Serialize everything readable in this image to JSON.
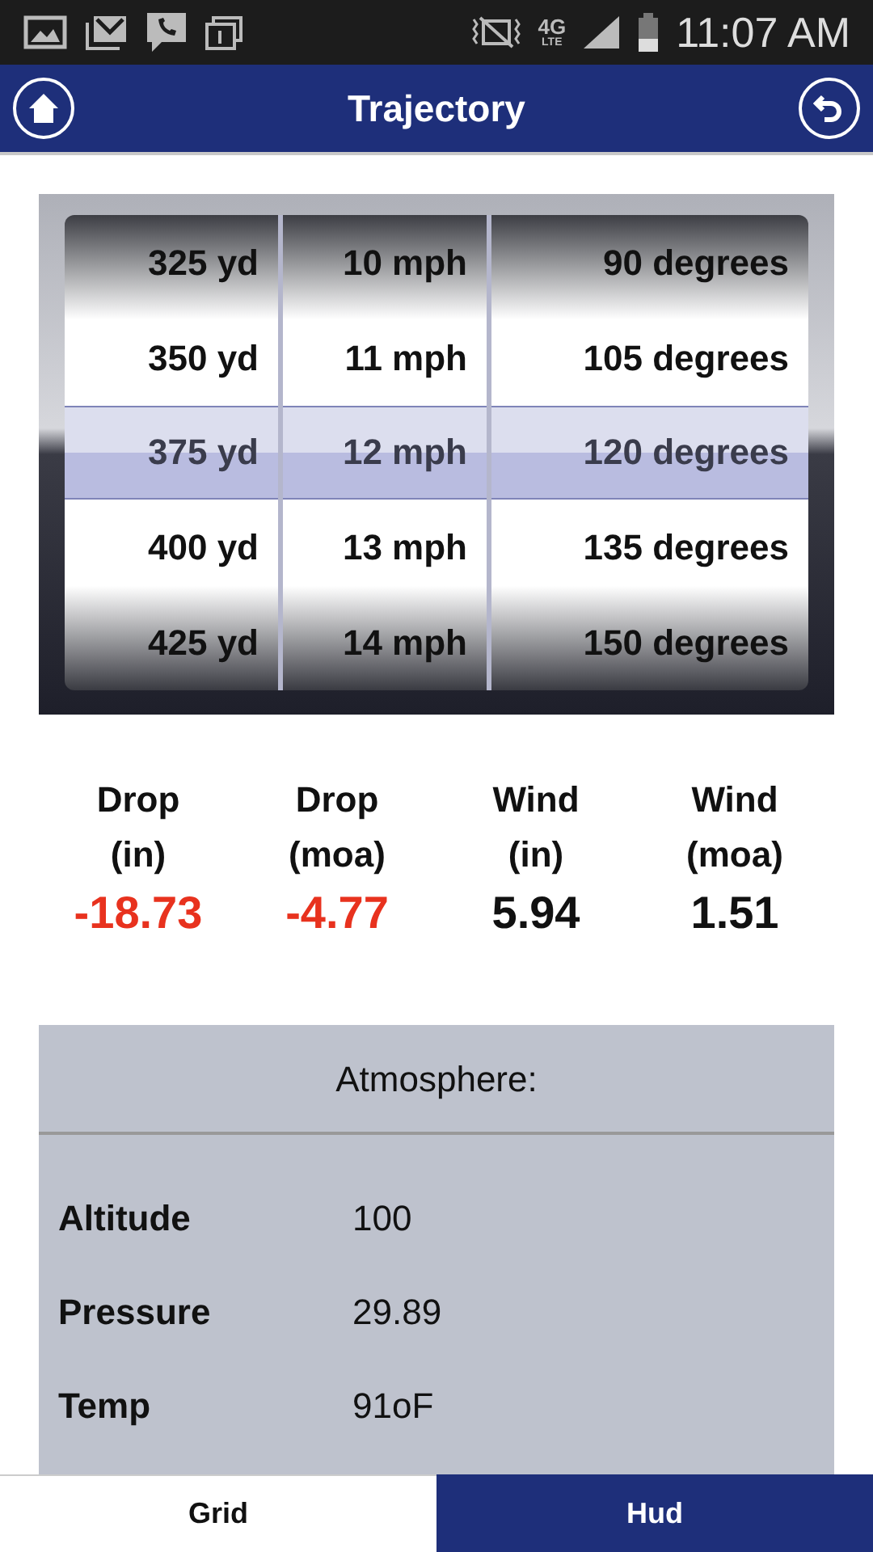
{
  "status_bar": {
    "network": "4G",
    "network_sub": "LTE",
    "time": "11:07 AM"
  },
  "header": {
    "title": "Trajectory"
  },
  "picker": {
    "columns": [
      {
        "items": [
          {
            "label": "325 yd",
            "selected": false
          },
          {
            "label": "350 yd",
            "selected": false
          },
          {
            "label": "375 yd",
            "selected": true
          },
          {
            "label": "400 yd",
            "selected": false
          },
          {
            "label": "425 yd",
            "selected": false
          }
        ]
      },
      {
        "items": [
          {
            "label": "10 mph",
            "selected": false
          },
          {
            "label": "11 mph",
            "selected": false
          },
          {
            "label": "12 mph",
            "selected": true
          },
          {
            "label": "13 mph",
            "selected": false
          },
          {
            "label": "14 mph",
            "selected": false
          }
        ]
      },
      {
        "items": [
          {
            "label": "90 degrees",
            "selected": false
          },
          {
            "label": "105 degrees",
            "selected": false
          },
          {
            "label": "120 degrees",
            "selected": true
          },
          {
            "label": "135 degrees",
            "selected": false
          },
          {
            "label": "150 degrees",
            "selected": false
          }
        ]
      }
    ]
  },
  "results": [
    {
      "label": "Drop",
      "unit": "(in)",
      "value": "-18.73",
      "color": "#e8321e"
    },
    {
      "label": "Drop",
      "unit": "(moa)",
      "value": "-4.77",
      "color": "#e8321e"
    },
    {
      "label": "Wind",
      "unit": "(in)",
      "value": "5.94",
      "color": "#111111"
    },
    {
      "label": "Wind",
      "unit": "(moa)",
      "value": "1.51",
      "color": "#111111"
    }
  ],
  "atmosphere": {
    "title": "Atmosphere:",
    "rows": [
      {
        "label": "Altitude",
        "value": "100"
      },
      {
        "label": "Pressure",
        "value": "29.89"
      },
      {
        "label": "Temp",
        "value": "91oF"
      }
    ]
  },
  "bottom_tabs": [
    {
      "label": "Grid",
      "selected": false
    },
    {
      "label": "Hud",
      "selected": true
    }
  ]
}
